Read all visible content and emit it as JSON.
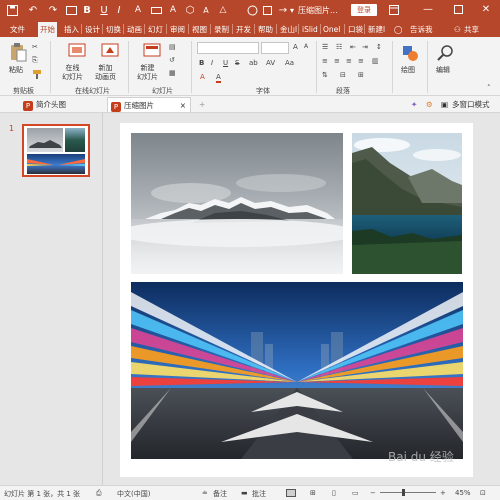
{
  "titlebar": {
    "doc_title": "压缩图片...",
    "login_label": "登录",
    "icons": [
      "save-icon",
      "undo-icon",
      "redo-icon",
      "start-from-beginning-icon",
      "bold-icon",
      "underline-icon",
      "italic-icon",
      "font-size-icon",
      "rectangle-icon",
      "textbox-icon",
      "circle-icon",
      "square-icon",
      "arrow-icon",
      "customize-icon"
    ]
  },
  "tabs": [
    "文件",
    "开始",
    "插入",
    "设计",
    "切换",
    "动画",
    "幻灯",
    "审阅",
    "视图",
    "录制",
    "开发",
    "帮助",
    "金山l",
    "iSlid",
    "Onel",
    "口袋",
    "新建l"
  ],
  "tell_me": "告诉我",
  "share": "共享",
  "colors": {
    "accent": "#b7472a",
    "highlight": "#d24726"
  },
  "ribbon": {
    "clipboard": {
      "label": "剪贴板",
      "paste": "粘贴"
    },
    "slides_online": {
      "label": "在线幻灯片",
      "online": "在线\n幻灯片",
      "new_anim": "新加\n动画页"
    },
    "slides": {
      "label": "幻灯片",
      "new_slide": "新建\n幻灯片"
    },
    "font": {
      "label": "字体",
      "format_buttons": [
        "B",
        "I",
        "U",
        "S",
        "ab",
        "AV",
        "Aa",
        "A",
        "A"
      ]
    },
    "paragraph": {
      "label": "段落"
    },
    "drawing": {
      "label": "绘图"
    },
    "editing": {
      "label": "编辑"
    }
  },
  "doctabs": [
    {
      "label": "简介头图"
    },
    {
      "label": "压缩图片"
    }
  ],
  "multi_window": "多窗口模式",
  "thumb": {
    "number": "1"
  },
  "status": {
    "slide_info": "幻灯片 第 1 张，共 1 张",
    "language": "中文(中国)",
    "notes": "备注",
    "comments": "批注",
    "zoom": "45%",
    "watermark": "Bai du 经验"
  }
}
